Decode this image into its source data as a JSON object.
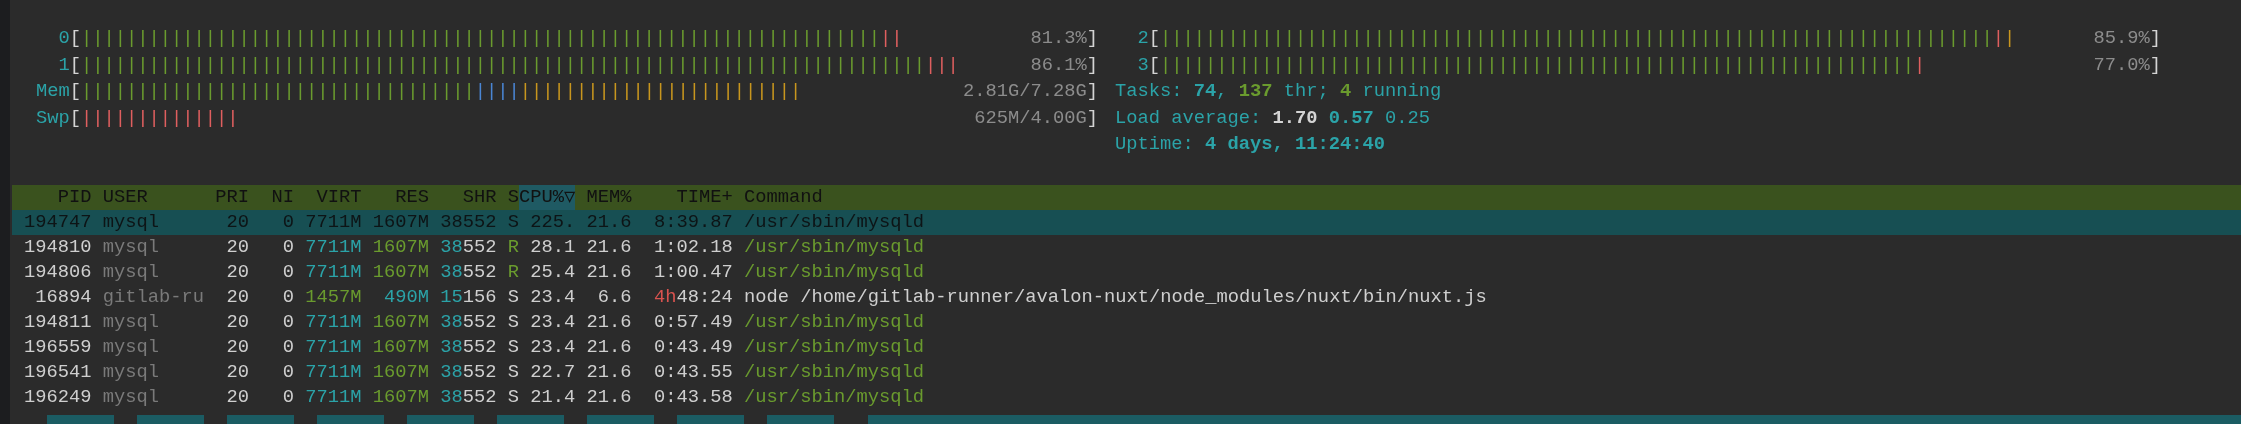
{
  "meters_left": [
    {
      "label": "0",
      "open": "[",
      "close": "]",
      "value": "81.3%",
      "segments": [
        {
          "text": "|||||||||||||||||||||||||||||||||||||||||||||||||||||||||||||||||||||||",
          "color": "#6a9b2e"
        },
        {
          "text": "||",
          "color": "#df5f5f"
        }
      ]
    },
    {
      "label": "1",
      "open": "[",
      "close": "]",
      "value": "86.1%",
      "segments": [
        {
          "text": "|||||||||||||||||||||||||||||||||||||||||||||||||||||||||||||||||||||||||||",
          "color": "#6a9b2e"
        },
        {
          "text": "|||",
          "color": "#df5f5f"
        }
      ]
    },
    {
      "label": "Mem",
      "open": "[",
      "close": "]",
      "value": "2.81G/7.28G",
      "segments": [
        {
          "text": "|||||||||||||||||||||||||||||||||||",
          "color": "#6a9b2e"
        },
        {
          "text": "||||",
          "color": "#4a86d4"
        },
        {
          "text": "|||||||||||||||||||||||||",
          "color": "#c8961e"
        }
      ]
    },
    {
      "label": "Swp",
      "open": "[",
      "close": "]",
      "value": "625M/4.00G",
      "segments": [
        {
          "text": "||||||||||||||",
          "color": "#df5f5f"
        }
      ]
    }
  ],
  "meters_right": [
    {
      "label": "2",
      "open": "[",
      "close": "]",
      "value": "85.9%",
      "segments": [
        {
          "text": "||||||||||||||||||||||||||||||||||||||||||||||||||||||||||||||||||||||||||",
          "color": "#6a9b2e"
        },
        {
          "text": "|",
          "color": "#df5f5f"
        },
        {
          "text": "|",
          "color": "#c8961e"
        }
      ]
    },
    {
      "label": "3",
      "open": "[",
      "close": "]",
      "value": "77.0%",
      "segments": [
        {
          "text": "|||||||||||||||||||||||||||||||||||||||||||||||||||||||||||||||||||",
          "color": "#6a9b2e"
        },
        {
          "text": "|",
          "color": "#df5f5f"
        }
      ]
    }
  ],
  "summary": [
    {
      "parts": [
        {
          "text": "Tasks: ",
          "color": "#2ba3a8",
          "bold": false
        },
        {
          "text": "74",
          "color": "#2ba3a8",
          "bold": true
        },
        {
          "text": ", ",
          "color": "#2ba3a8",
          "bold": false
        },
        {
          "text": "137",
          "color": "#6a9b2e",
          "bold": true
        },
        {
          "text": " thr; ",
          "color": "#2ba3a8",
          "bold": false
        },
        {
          "text": "4",
          "color": "#6a9b2e",
          "bold": true
        },
        {
          "text": " running",
          "color": "#2ba3a8",
          "bold": false
        }
      ]
    },
    {
      "parts": [
        {
          "text": "Load average: ",
          "color": "#2ba3a8",
          "bold": false
        },
        {
          "text": "1.70",
          "color": "#d4d4d4",
          "bold": true
        },
        {
          "text": " 0.57",
          "color": "#2ba3a8",
          "bold": true
        },
        {
          "text": " 0.25",
          "color": "#2ba3a8",
          "bold": false
        }
      ]
    },
    {
      "parts": [
        {
          "text": "Uptime: ",
          "color": "#2ba3a8",
          "bold": false
        },
        {
          "text": "4 days, 11:24:40",
          "color": "#2ba3a8",
          "bold": true
        }
      ]
    }
  ],
  "table": {
    "columns": [
      {
        "label": "PID",
        "sorted": false
      },
      {
        "label": "USER",
        "sorted": false
      },
      {
        "label": "PRI",
        "sorted": false
      },
      {
        "label": "NI",
        "sorted": false
      },
      {
        "label": "VIRT",
        "sorted": false
      },
      {
        "label": "RES",
        "sorted": false
      },
      {
        "label": "SHR",
        "sorted": false
      },
      {
        "label": "S",
        "sorted": false
      },
      {
        "label": "CPU%▽",
        "sorted": true
      },
      {
        "label": "MEM%",
        "sorted": false
      },
      {
        "label": "TIME+",
        "sorted": false
      },
      {
        "label": "Command",
        "sorted": false
      }
    ],
    "rows": [
      {
        "selected": true,
        "pid": "194747",
        "user": "mysql",
        "pri": "20",
        "ni": "0",
        "virt": [
          {
            "text": "7711M"
          }
        ],
        "res": [
          {
            "text": "1607M"
          }
        ],
        "shr": [
          {
            "text": "38552"
          }
        ],
        "state": "S",
        "cpu": "225.",
        "mem": "21.6",
        "time": [
          {
            "text": "8:39.87"
          }
        ],
        "command": "/usr/sbin/mysqld"
      },
      {
        "selected": false,
        "kind": "thread",
        "running": true,
        "pid": "194810",
        "user": "mysql",
        "pri": "20",
        "ni": "0",
        "virt": [
          {
            "text": "7711M",
            "color": "#2ba3a8"
          }
        ],
        "res": [
          {
            "text": "1607M",
            "color": "#6a9b2e"
          }
        ],
        "shr": [
          {
            "text": "38",
            "color": "#2ba3a8"
          },
          {
            "text": "552"
          }
        ],
        "state": "R",
        "cpu": "28.1",
        "mem": "21.6",
        "time": [
          {
            "text": "1:02.18"
          }
        ],
        "command": "/usr/sbin/mysqld"
      },
      {
        "selected": false,
        "kind": "thread",
        "running": true,
        "pid": "194806",
        "user": "mysql",
        "pri": "20",
        "ni": "0",
        "virt": [
          {
            "text": "7711M",
            "color": "#2ba3a8"
          }
        ],
        "res": [
          {
            "text": "1607M",
            "color": "#6a9b2e"
          }
        ],
        "shr": [
          {
            "text": "38",
            "color": "#2ba3a8"
          },
          {
            "text": "552"
          }
        ],
        "state": "R",
        "cpu": "25.4",
        "mem": "21.6",
        "time": [
          {
            "text": "1:00.47"
          }
        ],
        "command": "/usr/sbin/mysqld"
      },
      {
        "selected": false,
        "kind": "process",
        "running": false,
        "pid": "16894",
        "user": "gitlab-ru",
        "pri": "20",
        "ni": "0",
        "virt": [
          {
            "text": "1457M",
            "color": "#6a9b2e"
          }
        ],
        "res": [
          {
            "text": "490M",
            "color": "#2ba3a8"
          }
        ],
        "shr": [
          {
            "text": "15",
            "color": "#2ba3a8"
          },
          {
            "text": "156"
          }
        ],
        "state": "S",
        "cpu": "23.4",
        "mem": "6.6",
        "time": [
          {
            "text": "4h",
            "color": "#d9534f"
          },
          {
            "text": "48:24"
          }
        ],
        "command": "node /home/gitlab-runner/avalon-nuxt/node_modules/nuxt/bin/nuxt.js"
      },
      {
        "selected": false,
        "kind": "thread",
        "running": false,
        "pid": "194811",
        "user": "mysql",
        "pri": "20",
        "ni": "0",
        "virt": [
          {
            "text": "7711M",
            "color": "#2ba3a8"
          }
        ],
        "res": [
          {
            "text": "1607M",
            "color": "#6a9b2e"
          }
        ],
        "shr": [
          {
            "text": "38",
            "color": "#2ba3a8"
          },
          {
            "text": "552"
          }
        ],
        "state": "S",
        "cpu": "23.4",
        "mem": "21.6",
        "time": [
          {
            "text": "0:57.49"
          }
        ],
        "command": "/usr/sbin/mysqld"
      },
      {
        "selected": false,
        "kind": "thread",
        "running": false,
        "pid": "196559",
        "user": "mysql",
        "pri": "20",
        "ni": "0",
        "virt": [
          {
            "text": "7711M",
            "color": "#2ba3a8"
          }
        ],
        "res": [
          {
            "text": "1607M",
            "color": "#6a9b2e"
          }
        ],
        "shr": [
          {
            "text": "38",
            "color": "#2ba3a8"
          },
          {
            "text": "552"
          }
        ],
        "state": "S",
        "cpu": "23.4",
        "mem": "21.6",
        "time": [
          {
            "text": "0:43.49"
          }
        ],
        "command": "/usr/sbin/mysqld"
      },
      {
        "selected": false,
        "kind": "thread",
        "running": false,
        "pid": "196541",
        "user": "mysql",
        "pri": "20",
        "ni": "0",
        "virt": [
          {
            "text": "7711M",
            "color": "#2ba3a8"
          }
        ],
        "res": [
          {
            "text": "1607M",
            "color": "#6a9b2e"
          }
        ],
        "shr": [
          {
            "text": "38",
            "color": "#2ba3a8"
          },
          {
            "text": "552"
          }
        ],
        "state": "S",
        "cpu": "22.7",
        "mem": "21.6",
        "time": [
          {
            "text": "0:43.55"
          }
        ],
        "command": "/usr/sbin/mysqld"
      },
      {
        "selected": false,
        "kind": "thread",
        "running": false,
        "pid": "196249",
        "user": "mysql",
        "pri": "20",
        "ni": "0",
        "virt": [
          {
            "text": "7711M",
            "color": "#2ba3a8"
          }
        ],
        "res": [
          {
            "text": "1607M",
            "color": "#6a9b2e"
          }
        ],
        "shr": [
          {
            "text": "38",
            "color": "#2ba3a8"
          },
          {
            "text": "552"
          }
        ],
        "state": "S",
        "cpu": "21.4",
        "mem": "21.6",
        "time": [
          {
            "text": "0:43.58"
          }
        ],
        "command": "/usr/sbin/mysqld"
      }
    ]
  }
}
